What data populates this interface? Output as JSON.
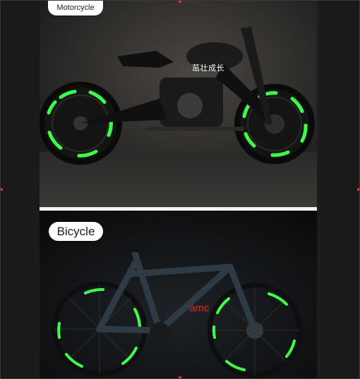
{
  "top_panel": {
    "label": "Motorcycle",
    "watermark": "茁壮成长"
  },
  "bottom_panel": {
    "label": "Bicycle",
    "watermark": "amc"
  },
  "colors": {
    "reflective_strip": "#3dff4a",
    "label_bg": "#ffffff",
    "watermark_red": "#d62a2a"
  }
}
